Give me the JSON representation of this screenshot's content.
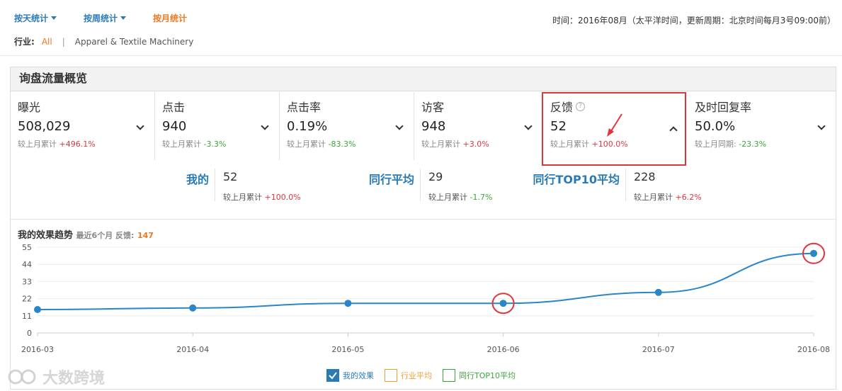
{
  "nav": {
    "tabs": [
      {
        "label": "按天统计",
        "active": false,
        "caret": true
      },
      {
        "label": "按周统计",
        "active": false,
        "caret": true
      },
      {
        "label": "按月统计",
        "active": true,
        "caret": false
      }
    ]
  },
  "time_info": "时间：2016年08月（太平洋时间，更新周期：北京时间每月3号09:00前）",
  "industry": {
    "label": "行业:",
    "all": "All",
    "separator": "|",
    "category": "Apparel & Textile Machinery"
  },
  "panel": {
    "title": "询盘流量概览"
  },
  "metrics": [
    {
      "name": "曝光",
      "value": "508,029",
      "compare_label": "较上月累计",
      "change": "+496.1%",
      "dir": "up"
    },
    {
      "name": "点击",
      "value": "940",
      "compare_label": "较上月累计",
      "change": "-3.3%",
      "dir": "down"
    },
    {
      "name": "点击率",
      "value": "0.19%",
      "compare_label": "较上月累计",
      "change": "-83.3%",
      "dir": "down"
    },
    {
      "name": "访客",
      "value": "948",
      "compare_label": "较上月累计",
      "change": "+3.0%",
      "dir": "up"
    },
    {
      "name": "反馈",
      "value": "52",
      "compare_label": "较上月累计",
      "change": "+100.0%",
      "dir": "up",
      "help": "?",
      "expanded": true
    },
    {
      "name": "及时回复率",
      "value": "50.0%",
      "compare_label": "较上月同期:",
      "change": "-23.3%",
      "dir": "down"
    }
  ],
  "detail": [
    {
      "label": "我的",
      "value": "52",
      "compare_label": "较上月累计",
      "change": "+100.0%",
      "dir": "up"
    },
    {
      "label": "同行平均",
      "value": "29",
      "compare_label": "较上月累计",
      "change": "-1.7%",
      "dir": "down"
    },
    {
      "label": "同行TOP10平均",
      "value": "228",
      "compare_label": "较上月累计",
      "change": "+6.2%",
      "dir": "up"
    }
  ],
  "trend": {
    "title": "我的效果趋势",
    "subtitle": "最近6个月 反馈:",
    "count": "147"
  },
  "chart_data": {
    "type": "line",
    "categories": [
      "2016-03",
      "2016-04",
      "2016-05",
      "2016-06",
      "2016-07",
      "2016-08"
    ],
    "yticks": [
      0,
      11,
      22,
      33,
      44,
      55
    ],
    "ylim": [
      0,
      55
    ],
    "series": [
      {
        "name": "我的效果",
        "values": [
          15,
          16,
          19,
          19,
          26,
          51
        ],
        "color": "#2a86c9",
        "visible": true
      }
    ],
    "highlighted_points": [
      "2016-06",
      "2016-08"
    ],
    "grid": true,
    "legend": [
      {
        "label": "我的效果",
        "checked": true,
        "color": "#2a7ab8"
      },
      {
        "label": "行业平均",
        "checked": false,
        "color": "#f0a030"
      },
      {
        "label": "同行TOP10平均",
        "checked": false,
        "color": "#3aa53a"
      }
    ]
  },
  "watermark": "大数跨境",
  "colors": {
    "accent_blue": "#2a7ab8",
    "accent_orange": "#f0771f",
    "highlight_red": "#e0353b",
    "up": "#d9363e",
    "down": "#3aa53a"
  }
}
